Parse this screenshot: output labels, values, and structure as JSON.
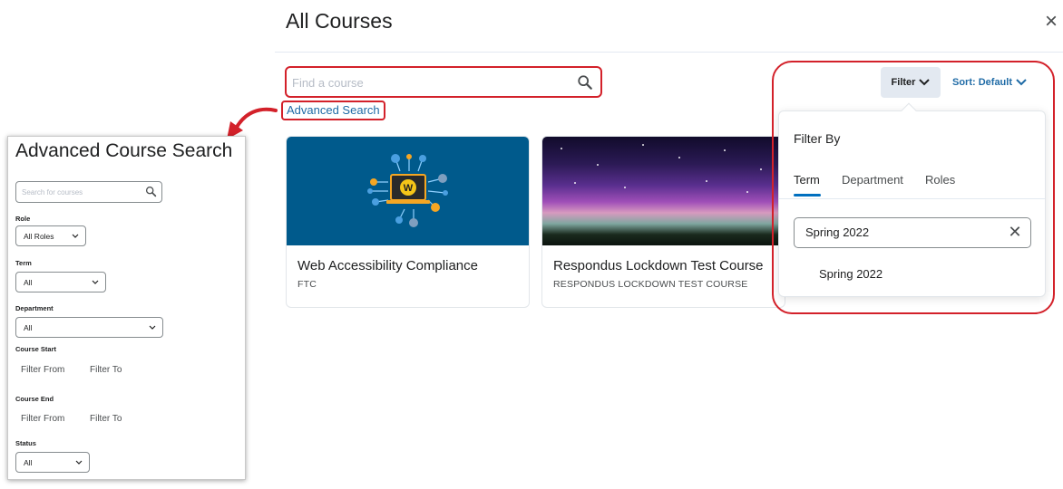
{
  "header": {
    "title": "All Courses",
    "close_glyph": "×"
  },
  "search": {
    "placeholder": "Find a course",
    "value": ""
  },
  "advanced_search_link": "Advanced Search",
  "toolbar": {
    "filter_label": "Filter",
    "sort_label": "Sort: Default"
  },
  "courses": [
    {
      "name": "Web Accessibility Compliance",
      "code": "FTC",
      "image_icon": "accessibility-circuit-w-icon"
    },
    {
      "name": "Respondus Lockdown Test Course",
      "code": "RESPONDUS LOCKDOWN TEST COURSE",
      "image_icon": "aurora-night-sky-image"
    }
  ],
  "filter_dropdown": {
    "title": "Filter By",
    "tabs": [
      "Term",
      "Department",
      "Roles"
    ],
    "active_tab": "Term",
    "search_value": "Spring 2022",
    "options": [
      "Spring 2022"
    ]
  },
  "advanced_panel": {
    "title": "Advanced Course Search",
    "search_placeholder": "Search for courses",
    "role_label": "Role",
    "role_value": "All Roles",
    "term_label": "Term",
    "term_value": "All",
    "department_label": "Department",
    "department_value": "All",
    "course_start_label": "Course Start",
    "course_end_label": "Course End",
    "filter_from": "Filter From",
    "filter_to": "Filter To",
    "status_label": "Status",
    "status_value": "All"
  },
  "colors": {
    "highlight": "#d3212a",
    "link": "#1f6ba6",
    "card_blue": "#005a8c",
    "active_tab": "#006fbf"
  }
}
